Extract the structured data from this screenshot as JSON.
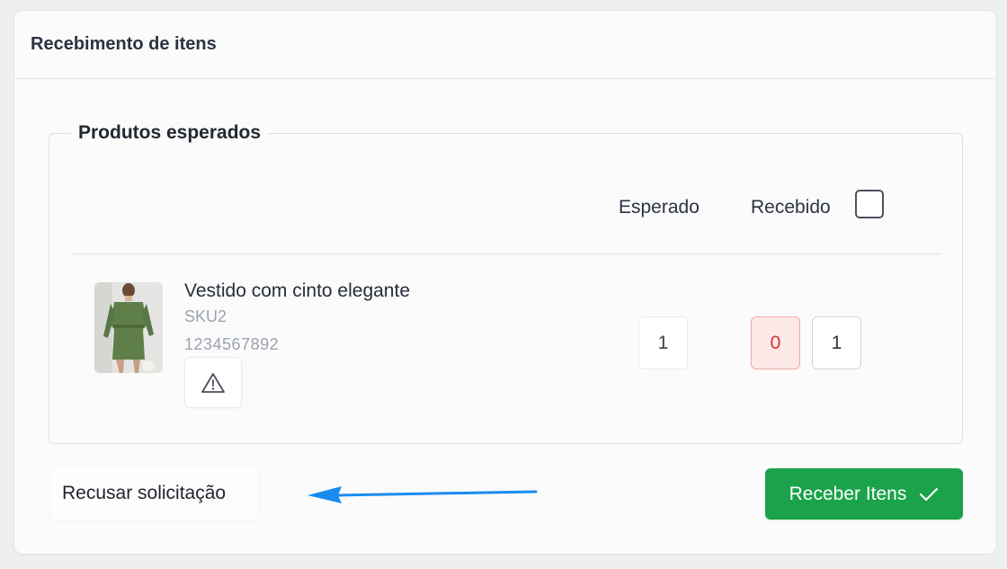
{
  "card": {
    "title": "Recebimento de itens"
  },
  "products": {
    "legend": "Produtos esperados",
    "columns": {
      "expected": "Esperado",
      "received": "Recebido"
    },
    "items": [
      {
        "name": "Vestido com cinto elegante",
        "sku": "SKU2",
        "code": "1234567892",
        "image_icon": "product-photo-green-dress",
        "warning_icon": "warning-triangle-icon",
        "expected_qty": "1",
        "received_status": "0",
        "received_input": "1"
      }
    ]
  },
  "actions": {
    "reject_label": "Recusar solicitação",
    "receive_label": "Receber Itens",
    "receive_icon": "checkmark-icon"
  },
  "colors": {
    "primary_green": "#1aa34a",
    "error_red": "#d33232",
    "annotation_arrow": "#1a8cf0"
  }
}
